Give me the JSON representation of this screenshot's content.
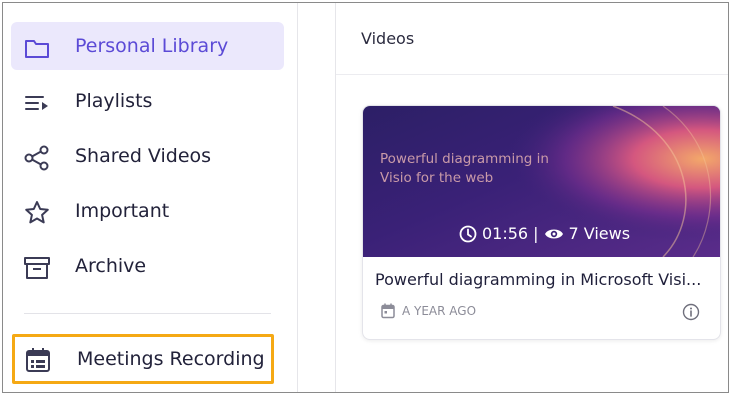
{
  "sidebar": {
    "items": [
      {
        "label": "Personal Library",
        "icon": "folder-icon"
      },
      {
        "label": "Playlists",
        "icon": "playlist-icon"
      },
      {
        "label": "Shared Videos",
        "icon": "share-icon"
      },
      {
        "label": "Important",
        "icon": "star-icon"
      },
      {
        "label": "Archive",
        "icon": "archive-icon"
      },
      {
        "label": "Meetings Recording",
        "icon": "calendar-icon"
      }
    ]
  },
  "main": {
    "title": "Videos",
    "videos": [
      {
        "thumbnail_text": "Powerful diagramming in Visio for the web",
        "duration": "01:56",
        "separator": "|",
        "views": "7 Views",
        "title": "Powerful diagramming in Microsoft Visi...",
        "date": "A YEAR AGO"
      }
    ]
  },
  "colors": {
    "accent": "#5b4ad6",
    "active_bg": "#ebe8fc",
    "highlight_border": "#f5a914"
  }
}
